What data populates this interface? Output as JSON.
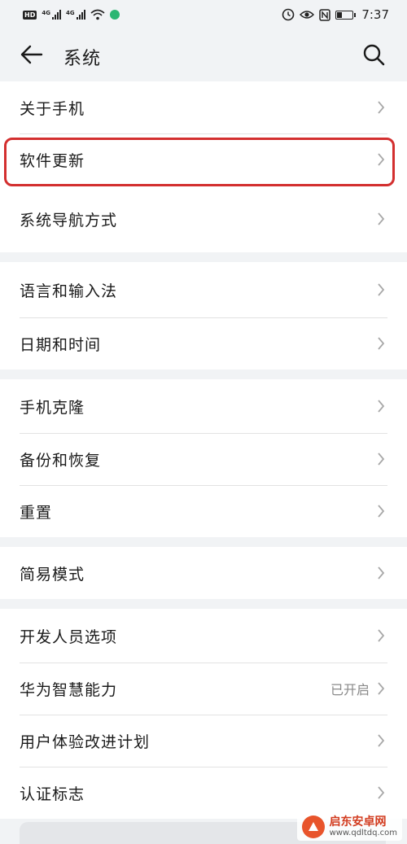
{
  "status_bar": {
    "hd": "HD",
    "net1": "4G",
    "net2": "4G",
    "time": "7:37",
    "wifi_color": "#2bb673"
  },
  "header": {
    "title": "系统",
    "back_icon": "arrow-left-icon",
    "search_icon": "search-icon"
  },
  "groups": [
    {
      "items": [
        {
          "label": "关于手机"
        },
        {
          "label": "软件更新",
          "highlighted": true
        },
        {
          "label": "系统导航方式"
        }
      ]
    },
    {
      "items": [
        {
          "label": "语言和输入法"
        },
        {
          "label": "日期和时间"
        }
      ]
    },
    {
      "items": [
        {
          "label": "手机克隆"
        },
        {
          "label": "备份和恢复"
        },
        {
          "label": "重置"
        }
      ]
    },
    {
      "items": [
        {
          "label": "简易模式"
        }
      ]
    },
    {
      "items": [
        {
          "label": "开发人员选项"
        },
        {
          "label": "华为智慧能力",
          "value": "已开启"
        },
        {
          "label": "用户体验改进计划"
        },
        {
          "label": "认证标志"
        }
      ]
    }
  ],
  "highlight_color": "#d32f2f",
  "watermark": {
    "name": "启东安卓网",
    "url": "www.qdltdq.com"
  }
}
